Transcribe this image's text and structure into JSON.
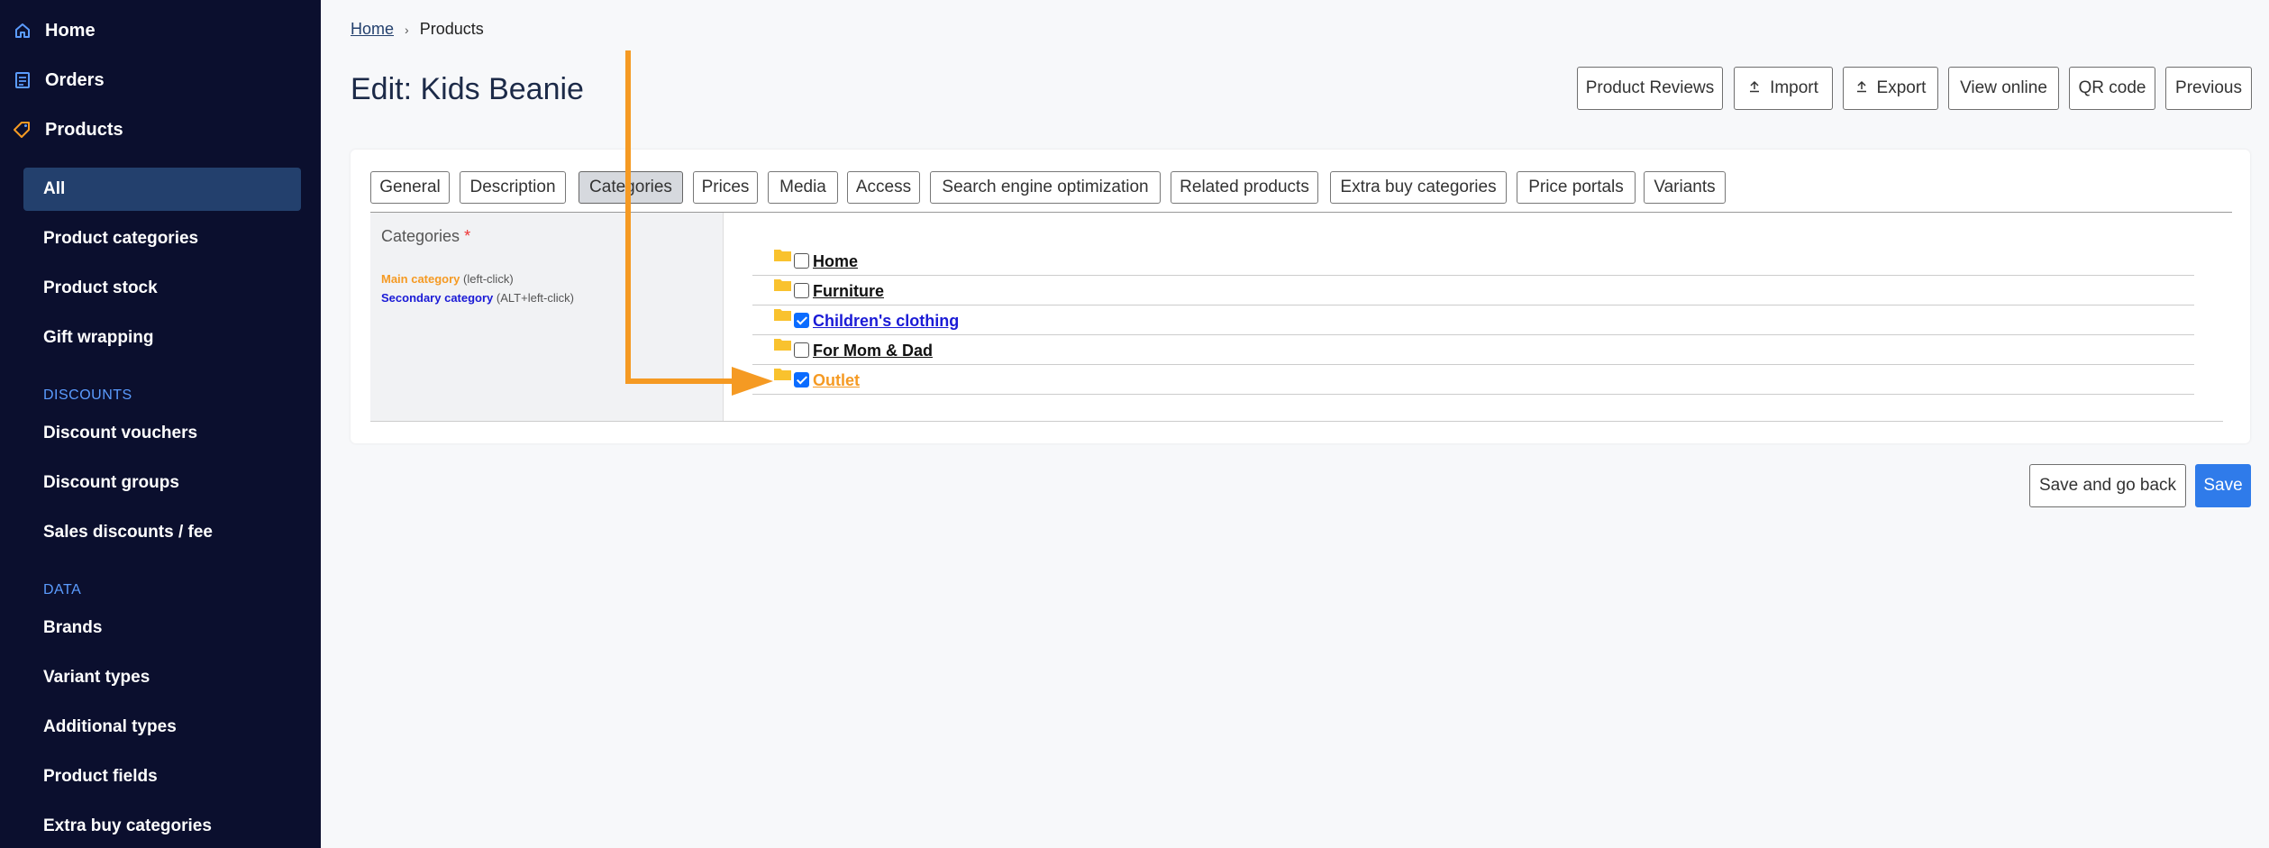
{
  "sidebar": {
    "top_items": [
      {
        "label": "Home",
        "icon": "home-icon"
      },
      {
        "label": "Orders",
        "icon": "list-icon"
      },
      {
        "label": "Products",
        "icon": "tag-icon"
      }
    ],
    "product_items": [
      "All",
      "Product categories",
      "Product stock",
      "Gift wrapping"
    ],
    "discounts_heading": "DISCOUNTS",
    "discount_items": [
      "Discount vouchers",
      "Discount groups",
      "Sales discounts / fee"
    ],
    "data_heading": "DATA",
    "data_items": [
      "Brands",
      "Variant types",
      "Additional types",
      "Product fields",
      "Extra buy categories"
    ]
  },
  "breadcrumb": {
    "home": "Home",
    "current": "Products",
    "separator": "›"
  },
  "page_title": "Edit: Kids Beanie",
  "header_buttons": {
    "reviews": "Product Reviews",
    "import": "Import",
    "export": "Export",
    "view_online": "View online",
    "qr_code": "QR code",
    "previous": "Previous"
  },
  "tabs": [
    "General",
    "Description",
    "Categories",
    "Prices",
    "Media",
    "Access",
    "Search engine optimization",
    "Related products",
    "Extra buy categories",
    "Price portals",
    "Variants"
  ],
  "active_tab": "Categories",
  "categories_panel": {
    "title": "Categories",
    "required_mark": "*",
    "main_legend": "Main category",
    "main_hint": "(left-click)",
    "secondary_legend": "Secondary category",
    "secondary_hint": "(ALT+left-click)"
  },
  "category_tree": [
    {
      "label": "Home",
      "checked": false,
      "role": "none"
    },
    {
      "label": "Furniture",
      "checked": false,
      "role": "none"
    },
    {
      "label": "Children's clothing",
      "checked": true,
      "role": "secondary"
    },
    {
      "label": "For Mom & Dad",
      "checked": false,
      "role": "none"
    },
    {
      "label": "Outlet",
      "checked": true,
      "role": "main"
    }
  ],
  "footer_buttons": {
    "save_back": "Save and go back",
    "save": "Save"
  },
  "colors": {
    "sidebar_bg": "#0b0f2e",
    "sidebar_active": "#23406d",
    "section_heading": "#5b9cff",
    "main_category": "#f59a23",
    "secondary_category": "#1a1ad6",
    "primary_button": "#2f7bea",
    "annotation_arrow": "#f59a23"
  }
}
